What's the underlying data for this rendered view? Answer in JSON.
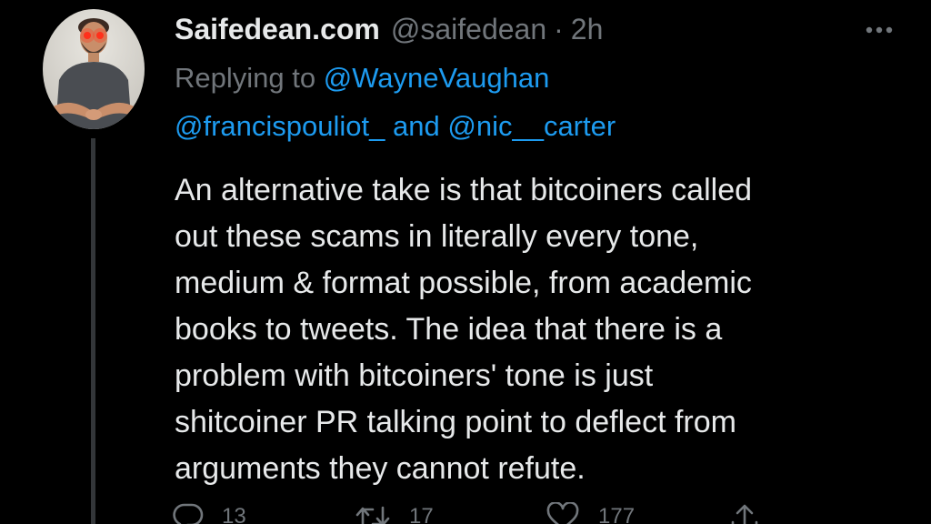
{
  "author": {
    "display_name": "Saifedean.com",
    "handle": "@saifedean",
    "separator": "·",
    "time": "2h",
    "avatar_icon": "avatar-photo"
  },
  "replying": {
    "prefix": "Replying to",
    "mention_1": "@WayneVaughan",
    "mention_2": "@francispouliot_",
    "conjunction": "and",
    "mention_3": "@nic__carter"
  },
  "tweet_lines": [
    "An alternative take is that bitcoiners called",
    "out these scams in literally every tone,",
    "medium & format possible, from academic",
    "books to tweets. The idea that there is a",
    "problem with bitcoiners' tone is just",
    "shitcoiner PR talking point to deflect from",
    "arguments they cannot refute."
  ],
  "actions": {
    "replies": "13",
    "retweets": "17",
    "likes": "177",
    "reply_icon": "speech-bubble-icon",
    "retweet_icon": "retweet-arrows-icon",
    "like_icon": "heart-icon",
    "share_icon": "share-upload-icon"
  },
  "colors": {
    "background": "#000000",
    "text": "#e7e9ea",
    "secondary": "#71767b",
    "link": "#1d9bf0",
    "thread_line": "#333639"
  }
}
